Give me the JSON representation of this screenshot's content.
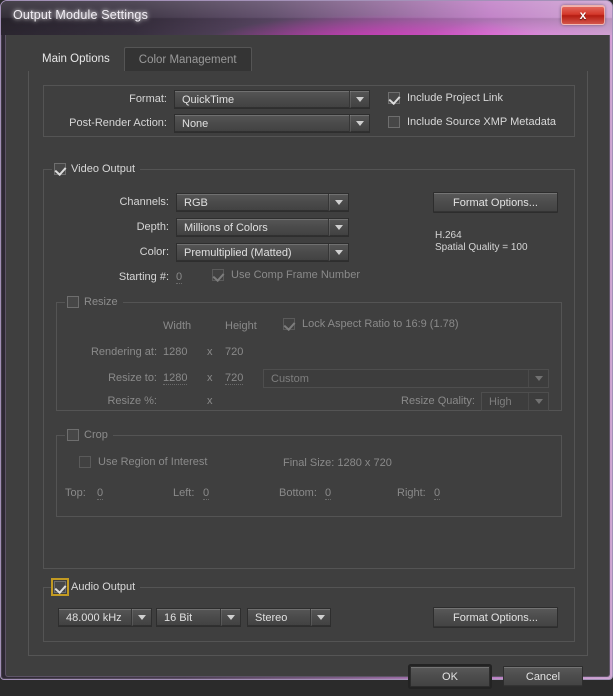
{
  "window": {
    "title": "Output Module Settings",
    "close_label": "x",
    "frame_accent": "#a391b8"
  },
  "tabs": [
    {
      "label": "Main Options",
      "active": true
    },
    {
      "label": "Color Management",
      "active": false
    }
  ],
  "format_section": {
    "format_label": "Format:",
    "format_value": "QuickTime",
    "post_render_label": "Post-Render Action:",
    "post_render_value": "None",
    "include_project_link": {
      "label": "Include Project Link",
      "checked": true
    },
    "include_xmp": {
      "label": "Include Source XMP Metadata",
      "checked": false
    }
  },
  "video_output": {
    "legend": "Video Output",
    "checked": true,
    "channels_label": "Channels:",
    "channels_value": "RGB",
    "depth_label": "Depth:",
    "depth_value": "Millions of Colors",
    "color_label": "Color:",
    "color_value": "Premultiplied (Matted)",
    "starting_label": "Starting #:",
    "starting_value": "0",
    "use_comp_frame": {
      "label": "Use Comp Frame Number",
      "checked": true
    },
    "format_options_button": "Format Options...",
    "codec_name": "H.264",
    "codec_quality": "Spatial Quality = 100"
  },
  "resize": {
    "legend": "Resize",
    "checked": false,
    "width_header": "Width",
    "height_header": "Height",
    "lock_aspect": {
      "label": "Lock Aspect Ratio to  16:9 (1.78)",
      "checked": true
    },
    "rendering_at_label": "Rendering at:",
    "rendering_width": "1280",
    "rendering_height": "720",
    "resize_to_label": "Resize to:",
    "resize_to_width": "1280",
    "resize_to_height": "720",
    "preset_value": "Custom",
    "resize_pct_label": "Resize %:",
    "times": "x",
    "quality_label": "Resize Quality:",
    "quality_value": "High"
  },
  "crop": {
    "legend": "Crop",
    "checked": false,
    "use_roi": {
      "label": "Use Region of Interest",
      "checked": false
    },
    "final_size": "Final Size: 1280 x 720",
    "top_label": "Top:",
    "top_value": "0",
    "left_label": "Left:",
    "left_value": "0",
    "bottom_label": "Bottom:",
    "bottom_value": "0",
    "right_label": "Right:",
    "right_value": "0"
  },
  "audio_output": {
    "legend": "Audio Output",
    "checked": true,
    "focused": true,
    "sample_rate": "48.000 kHz",
    "bit_depth": "16 Bit",
    "channels": "Stereo",
    "format_options_button": "Format Options..."
  },
  "footer": {
    "ok_label": "OK",
    "cancel_label": "Cancel"
  }
}
